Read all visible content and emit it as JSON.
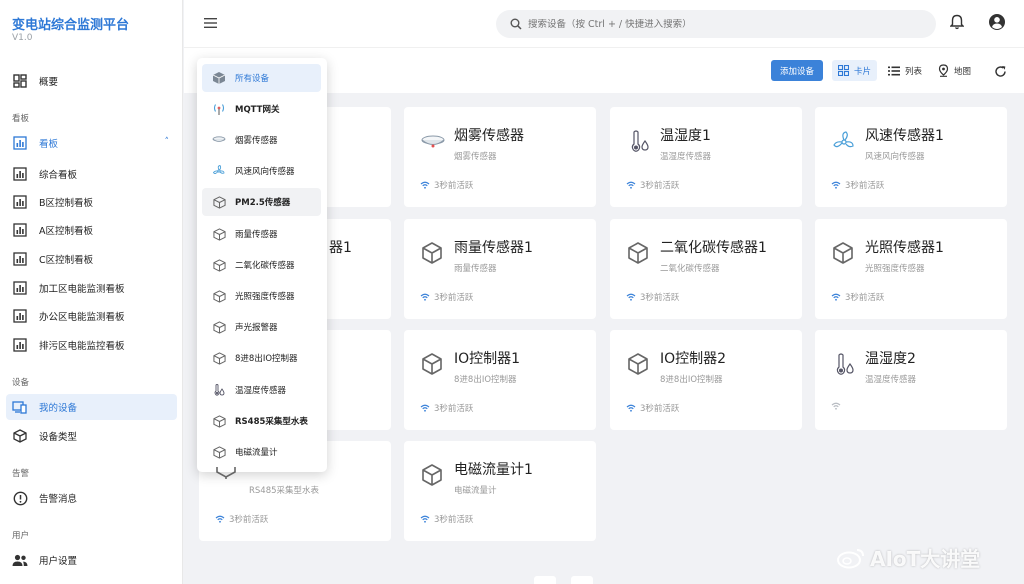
{
  "app": {
    "title": "变电站综合监测平台",
    "version": "V1.0"
  },
  "sidebar": {
    "overview": "概要",
    "section_board": "看板",
    "board_header": "看板",
    "boards": [
      "综合看板",
      "B区控制看板",
      "A区控制看板",
      "C区控制看板",
      "加工区电能监测看板",
      "办公区电能监测看板",
      "排污区电能监控看板"
    ],
    "section_device": "设备",
    "my_devices": "我的设备",
    "device_types": "设备类型",
    "section_alarm": "告警",
    "alarm_messages": "告警消息",
    "section_user": "用户",
    "user_settings": "用户设置"
  },
  "header": {
    "search_placeholder": "搜索设备（按 Ctrl + / 快捷进入搜索）"
  },
  "toolbar": {
    "add_device": "添加设备",
    "view_card": "卡片",
    "view_list": "列表",
    "view_map": "地图"
  },
  "dropdown": {
    "items": [
      "所有设备",
      "MQTT网关",
      "烟雾传感器",
      "风速风向传感器",
      "PM2.5传感器",
      "雨量传感器",
      "二氧化碳传感器",
      "光照强度传感器",
      "声光报警器",
      "8进8出IO控制器",
      "温湿度传感器",
      "RS485采集型水表",
      "电磁流量计"
    ]
  },
  "cards": [
    {
      "title": "",
      "sub": "",
      "status": ""
    },
    {
      "title": "烟雾传感器",
      "sub": "烟雾传感器",
      "status": "3秒前活跃"
    },
    {
      "title": "温湿度1",
      "sub": "温湿度传感器",
      "status": "3秒前活跃"
    },
    {
      "title": "风速传感器1",
      "sub": "风速风向传感器",
      "status": "3秒前活跃"
    },
    {
      "title": "器1",
      "sub": "",
      "status": ""
    },
    {
      "title": "雨量传感器1",
      "sub": "雨量传感器",
      "status": "3秒前活跃"
    },
    {
      "title": "二氧化碳传感器1",
      "sub": "二氧化碳传感器",
      "status": "3秒前活跃"
    },
    {
      "title": "光照传感器1",
      "sub": "光照强度传感器",
      "status": "3秒前活跃"
    },
    {
      "title": "",
      "sub": "",
      "status": ""
    },
    {
      "title": "IO控制器1",
      "sub": "8进8出IO控制器",
      "status": "3秒前活跃"
    },
    {
      "title": "IO控制器2",
      "sub": "8进8出IO控制器",
      "status": "3秒前活跃"
    },
    {
      "title": "温湿度2",
      "sub": "温湿度传感器",
      "status": ""
    },
    {
      "title": "",
      "sub": "RS485采集型水表",
      "status": "3秒前活跃"
    },
    {
      "title": "电磁流量计1",
      "sub": "电磁流量计",
      "status": "3秒前活跃"
    }
  ],
  "watermark": "AIoT大讲堂",
  "colors": {
    "accent": "#2d78d6",
    "button": "#3b82d9",
    "background": "#f1f2f5"
  }
}
